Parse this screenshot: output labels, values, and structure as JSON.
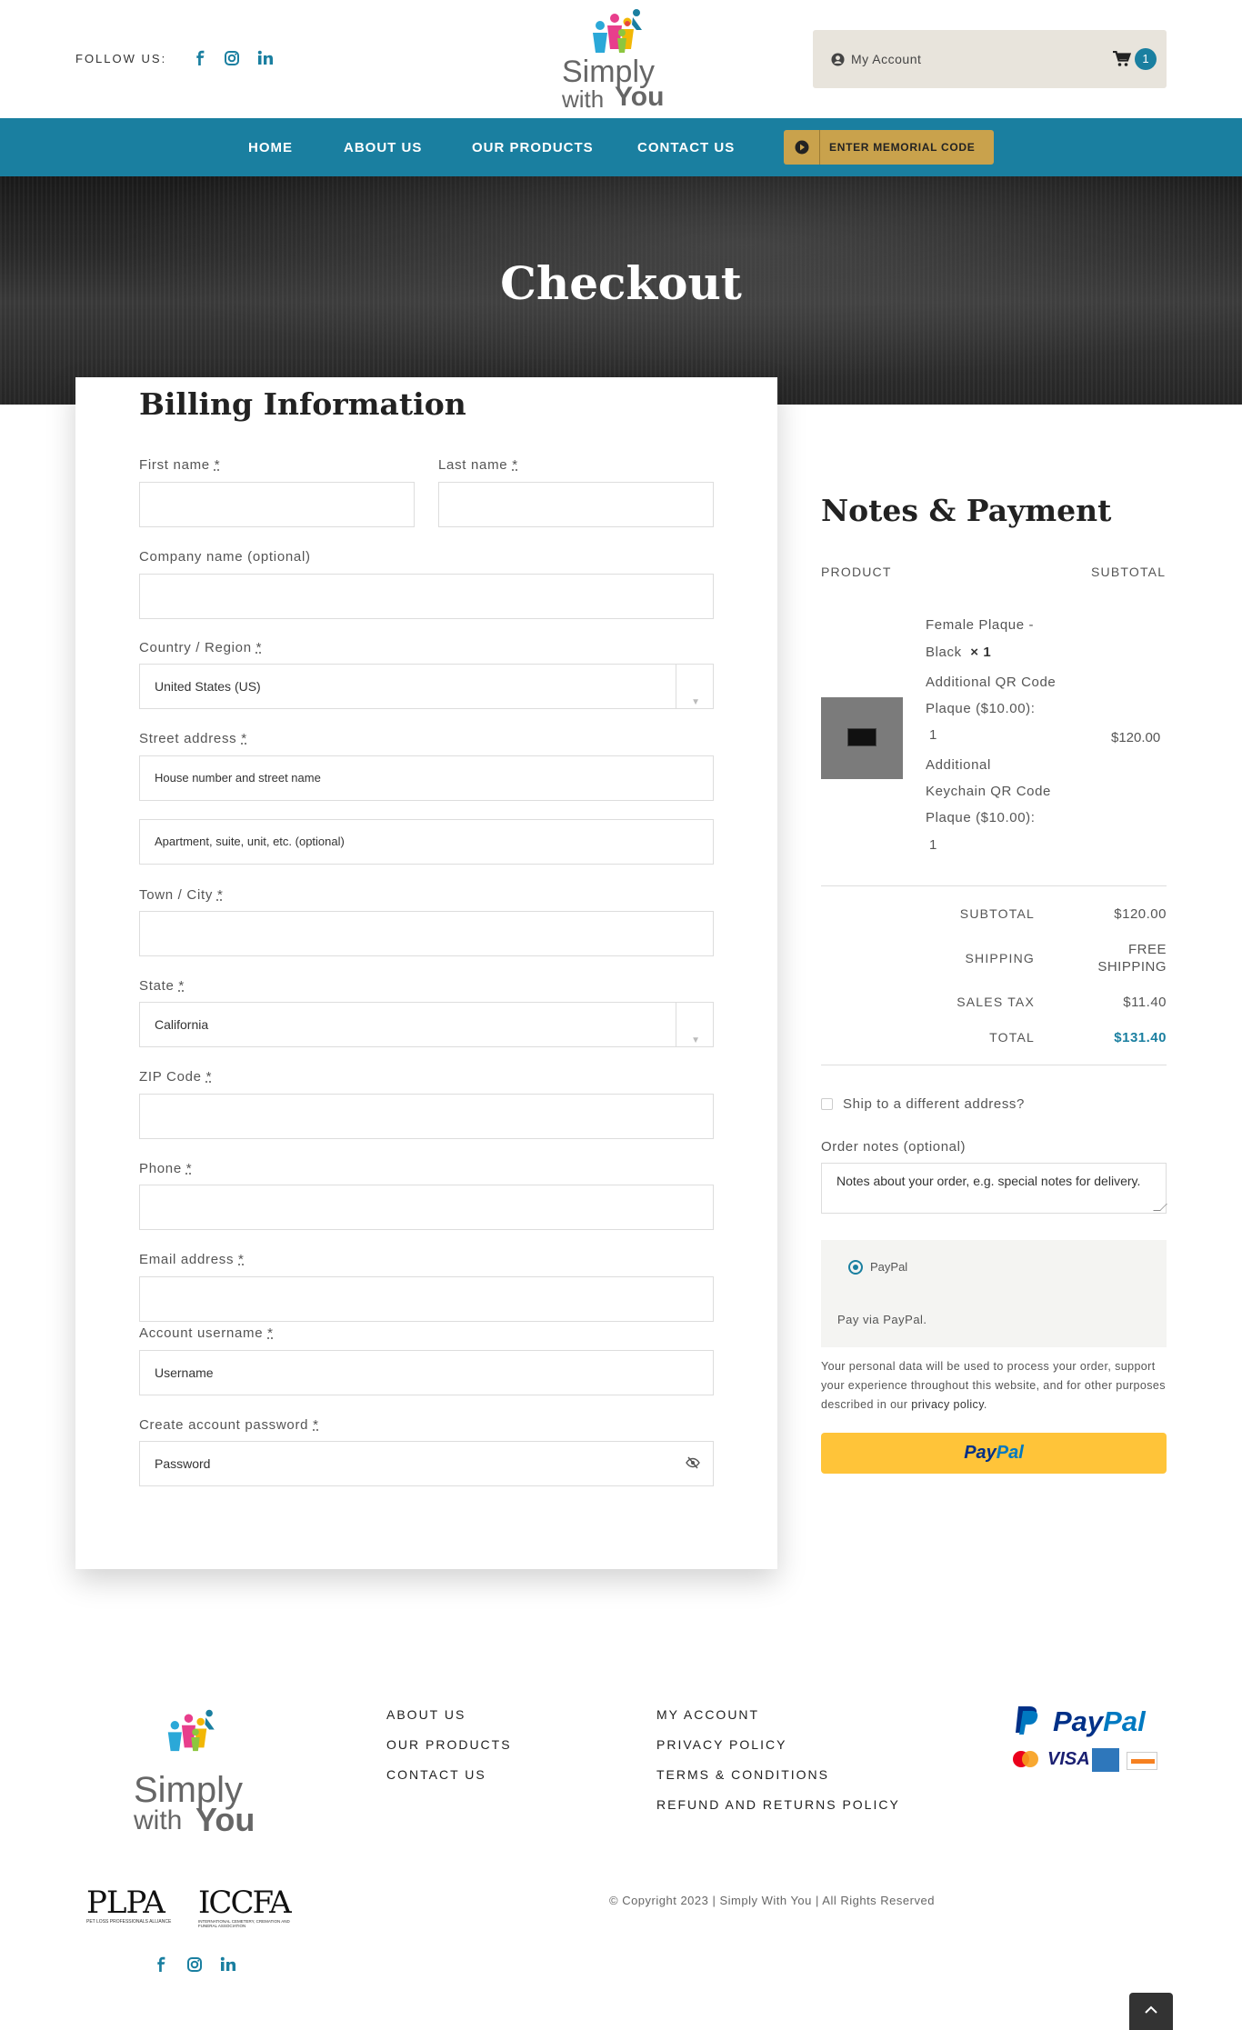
{
  "header": {
    "follow_label": "FOLLOW US:",
    "social_icons": [
      "facebook-icon",
      "instagram-icon",
      "linkedin-icon"
    ],
    "logo_text_1": "Simply",
    "logo_text_2": "with",
    "logo_text_3": "You",
    "account_label": "My Account",
    "cart_count": "1"
  },
  "nav": {
    "items": [
      "HOME",
      "ABOUT US",
      "OUR PRODUCTS",
      "CONTACT US"
    ],
    "memorial_button": "ENTER MEMORIAL CODE"
  },
  "hero": {
    "title": "Checkout"
  },
  "billing": {
    "title": "Billing Information",
    "first_name_label": "First name",
    "last_name_label": "Last name",
    "company_label": "Company name (optional)",
    "country_label": "Country / Region",
    "country_value": "United States (US)",
    "street_label": "Street address",
    "street_placeholder": "House number and street name",
    "street2_placeholder": "Apartment, suite, unit, etc. (optional)",
    "city_label": "Town / City",
    "state_label": "State",
    "state_value": "California",
    "zip_label": "ZIP Code",
    "phone_label": "Phone",
    "email_label": "Email address",
    "username_label": "Account username",
    "username_placeholder": "Username",
    "password_label": "Create account password",
    "password_placeholder": "Password",
    "required_mark": "*"
  },
  "order": {
    "title": "Notes & Payment",
    "col_product": "PRODUCT",
    "col_subtotal": "SUBTOTAL",
    "product_lines": [
      "Female Plaque -",
      "Black",
      "× 1",
      "Additional QR Code",
      "Plaque ($10.00):",
      "1",
      "Additional",
      "Keychain QR Code",
      "Plaque ($10.00):",
      "1"
    ],
    "product_price": "$120.00",
    "subtotal_label": "SUBTOTAL",
    "subtotal_value": "$120.00",
    "shipping_label": "SHIPPING",
    "shipping_value_1": "FREE",
    "shipping_value_2": "SHIPPING",
    "tax_label": "SALES TAX",
    "tax_value": "$11.40",
    "total_label": "TOTAL",
    "total_value": "$131.40",
    "ship_different_label": "Ship to a different address?",
    "notes_label": "Order notes (optional)",
    "notes_placeholder": "Notes about your order, e.g. special notes for delivery.",
    "payment_option": "PayPal",
    "payment_desc": "Pay via PayPal.",
    "privacy_text": "Your personal data will be used to process your order, support your experience throughout this website, and for other purposes described in our",
    "privacy_link": "privacy policy",
    "paypal_button_1": "Pay",
    "paypal_button_2": "Pal"
  },
  "footer": {
    "col1": [
      "ABOUT US",
      "OUR PRODUCTS",
      "CONTACT US"
    ],
    "col2": [
      "MY ACCOUNT",
      "PRIVACY POLICY",
      "TERMS & CONDITIONS",
      "REFUND AND RETURNS POLICY"
    ],
    "paypal_text_1": "Pay",
    "paypal_text_2": "Pal",
    "cards": [
      "MasterCard",
      "VISA",
      "AMEX",
      "DISCOVER"
    ],
    "plpa": "PLPA",
    "plpa_sub": "PET LOSS PROFESSIONALS ALLIANCE",
    "iccfa": "ICCFA",
    "iccfa_sub": "INTERNATIONAL CEMETERY, CREMATION AND FUNERAL ASSOCIATION",
    "copyright": "© Copyright 2023 | Simply With You | All Rights Reserved"
  },
  "colors": {
    "brand": "#1a7fa0",
    "gold": "#c9a24c",
    "paypal_yellow": "#ffc439"
  }
}
